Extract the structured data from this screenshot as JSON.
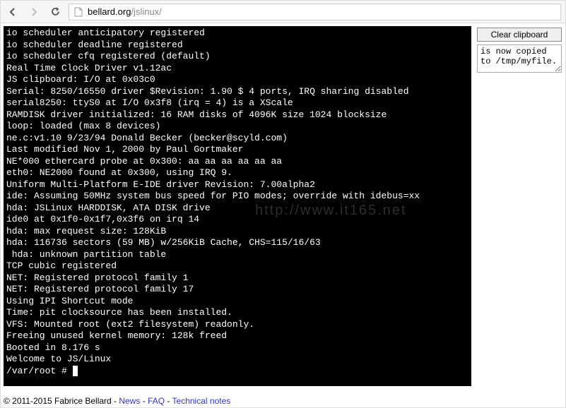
{
  "url": {
    "domain": "bellard.org",
    "path": "/jslinux/"
  },
  "terminal_lines": [
    "io scheduler anticipatory registered",
    "io scheduler deadline registered",
    "io scheduler cfq registered (default)",
    "Real Time Clock Driver v1.12ac",
    "JS clipboard: I/O at 0x03c0",
    "Serial: 8250/16550 driver $Revision: 1.90 $ 4 ports, IRQ sharing disabled",
    "serial8250: ttyS0 at I/O 0x3f8 (irq = 4) is a XScale",
    "RAMDISK driver initialized: 16 RAM disks of 4096K size 1024 blocksize",
    "loop: loaded (max 8 devices)",
    "ne.c:v1.10 9/23/94 Donald Becker (becker@scyld.com)",
    "Last modified Nov 1, 2000 by Paul Gortmaker",
    "NE*000 ethercard probe at 0x300: aa aa aa aa aa aa",
    "eth0: NE2000 found at 0x300, using IRQ 9.",
    "Uniform Multi-Platform E-IDE driver Revision: 7.00alpha2",
    "ide: Assuming 50MHz system bus speed for PIO modes; override with idebus=xx",
    "hda: JSLinux HARDDISK, ATA DISK drive",
    "ide0 at 0x1f0-0x1f7,0x3f6 on irq 14",
    "hda: max request size: 128KiB",
    "hda: 116736 sectors (59 MB) w/256KiB Cache, CHS=115/16/63",
    " hda: unknown partition table",
    "TCP cubic registered",
    "NET: Registered protocol family 1",
    "NET: Registered protocol family 17",
    "Using IPI Shortcut mode",
    "Time: pit clocksource has been installed.",
    "VFS: Mounted root (ext2 filesystem) readonly.",
    "Freeing unused kernel memory: 128k freed",
    "Booted in 8.176 s",
    "Welcome to JS/Linux"
  ],
  "prompt": "/var/root #",
  "sidebar": {
    "clear_label": "Clear clipboard",
    "clipboard_text": "is now copied to /tmp/myfile."
  },
  "footer": {
    "copyright": "© 2011-2015 Fabrice Bellard - ",
    "links": [
      "News",
      "FAQ",
      "Technical notes"
    ],
    "sep": " - "
  }
}
